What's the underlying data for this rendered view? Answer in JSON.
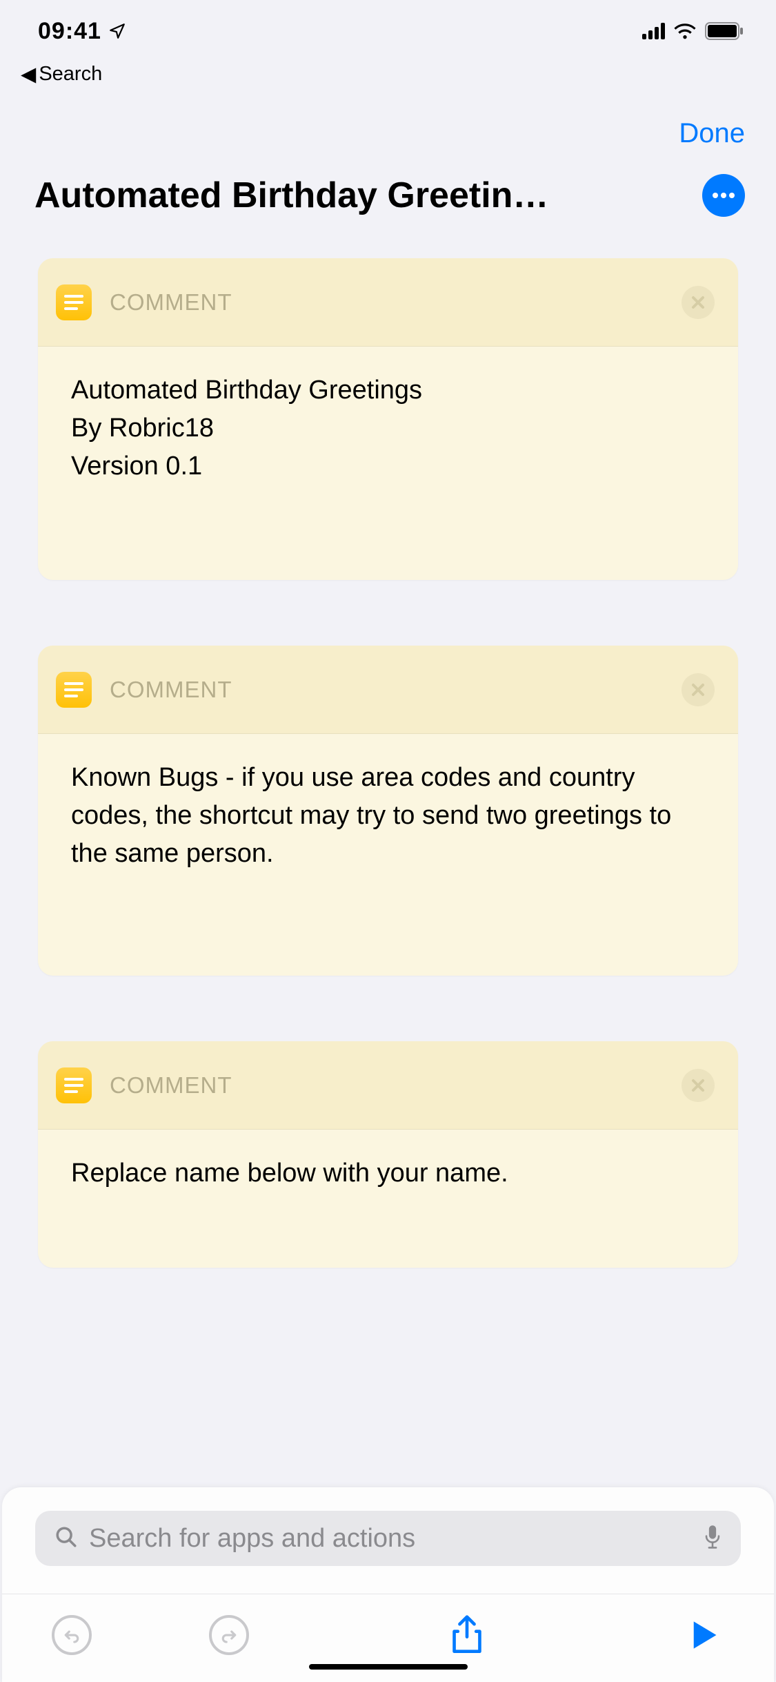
{
  "status": {
    "time": "09:41",
    "back_label": "Search"
  },
  "nav": {
    "done_label": "Done"
  },
  "title": "Automated Birthday Greetin…",
  "cards": [
    {
      "header_label": "COMMENT",
      "body": "Automated Birthday Greetings\nBy Robric18\nVersion 0.1"
    },
    {
      "header_label": "COMMENT",
      "body": "Known Bugs - if you use area codes and country codes, the shortcut may try to send two greetings to the same person."
    },
    {
      "header_label": "COMMENT",
      "body": "Replace name below with your name."
    }
  ],
  "search": {
    "placeholder": "Search for apps and actions"
  }
}
